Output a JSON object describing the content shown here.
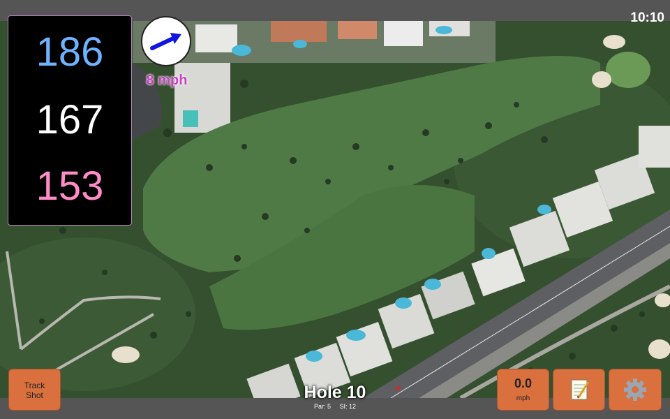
{
  "status_bar": {
    "time": "10:10"
  },
  "yardages": {
    "back": "186",
    "middle": "167",
    "front": "153"
  },
  "wind": {
    "speed_text": "8 mph",
    "direction_icon": "arrow-right-icon"
  },
  "buttons": {
    "track_shot_line1": "Track",
    "track_shot_line2": "Shot",
    "speed_value": "0.0",
    "speed_unit": "mph",
    "notes_icon": "notepad-icon",
    "settings_icon": "gear-icon"
  },
  "hole": {
    "title": "Hole 10",
    "par": "Par: 5",
    "stroke_index": "SI: 12"
  },
  "colors": {
    "back": "#6fb3ff",
    "middle": "#ffffff",
    "front": "#ff8cc8",
    "button": "#d9703e",
    "wind_text": "#c840c0"
  }
}
